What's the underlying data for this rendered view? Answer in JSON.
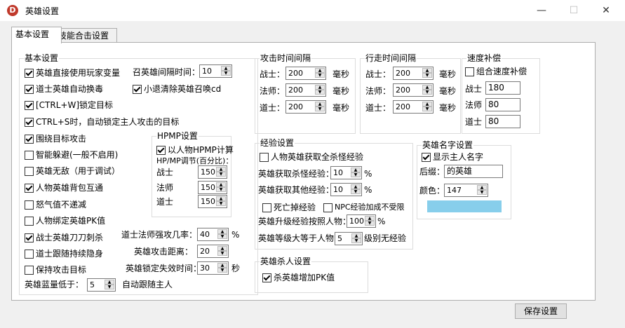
{
  "window": {
    "title": "英雄设置",
    "icon": "D",
    "minimize": "—",
    "maximize": "☐",
    "close": "✕"
  },
  "tabs": [
    {
      "label": "基本设置"
    },
    {
      "label": "技能合击设置"
    }
  ],
  "basic": {
    "title": "基本设置",
    "options": [
      {
        "label": "英雄直接使用玩家变量",
        "checked": true
      },
      {
        "label": "道士英雄自动换毒",
        "checked": true
      },
      {
        "label": "[CTRL+W]锁定目标",
        "checked": true
      },
      {
        "label": "CTRL+S时，自动锁定主人攻击的目标",
        "checked": true
      },
      {
        "label": "围绕目标攻击",
        "checked": true
      },
      {
        "label": "智能躲避(一般不启用)",
        "checked": false
      },
      {
        "label": "英雄无敌（用于调试）",
        "checked": false
      },
      {
        "label": "人物英雄背包互通",
        "checked": true
      },
      {
        "label": "怒气值不递减",
        "checked": false
      },
      {
        "label": "人物绑定英雄PK值",
        "checked": false
      },
      {
        "label": "战士英雄刀刀刺杀",
        "checked": true
      },
      {
        "label": "道士跟随持续隐身",
        "checked": false
      },
      {
        "label": "保持攻击目标",
        "checked": false
      }
    ],
    "summon_interval": {
      "label": "召英雄间隔时间：",
      "value": "10"
    },
    "retreat_clear": {
      "label": "小退清除英雄召唤cd",
      "checked": true
    },
    "tao_mage_rate": {
      "label": "道士法师强攻几率：",
      "value": "40",
      "unit": "%"
    },
    "attack_range": {
      "label": "英雄攻击距离：",
      "value": "20"
    },
    "lock_timeout": {
      "label": "英雄锁定失效时间：",
      "value": "30",
      "unit": "秒"
    },
    "mp_follow": {
      "label": "英雄蓝量低于：",
      "value": "5",
      "suffix": "自动跟随主人"
    }
  },
  "hpmp": {
    "title": "HPMP设置",
    "use_player": {
      "label": "以人物HPMP计算",
      "checked": true
    },
    "adjust_label": "HP/MP调节(百分比)：",
    "rows": [
      {
        "label": "战士",
        "value": "150"
      },
      {
        "label": "法师",
        "value": "150"
      },
      {
        "label": "道士",
        "value": "150"
      }
    ]
  },
  "attack_interval": {
    "title": "攻击时间间隔",
    "unit": "毫秒",
    "rows": [
      {
        "label": "战士：",
        "value": "200"
      },
      {
        "label": "法师：",
        "value": "200"
      },
      {
        "label": "道士：",
        "value": "200"
      }
    ]
  },
  "walk_interval": {
    "title": "行走时间间隔",
    "unit": "毫秒",
    "rows": [
      {
        "label": "战士：",
        "value": "200"
      },
      {
        "label": "法师：",
        "value": "200"
      },
      {
        "label": "道士：",
        "value": "200"
      }
    ]
  },
  "speed": {
    "title": "速度补偿",
    "combo": {
      "label": "组合速度补偿",
      "checked": false
    },
    "rows": [
      {
        "label": "战士",
        "value": "180"
      },
      {
        "label": "法师",
        "value": "80"
      },
      {
        "label": "道士",
        "value": "80"
      }
    ]
  },
  "exp": {
    "title": "经验设置",
    "all_kill": {
      "label": "人物英雄获取全杀怪经验",
      "checked": false
    },
    "kill_exp": {
      "label": "英雄获取杀怪经验：",
      "value": "10",
      "unit": "%"
    },
    "other_exp": {
      "label": "英雄获取其他经验：",
      "value": "10",
      "unit": "%"
    },
    "death_drop": {
      "label": "死亡掉经验",
      "checked": false
    },
    "npc_unlimited": {
      "label": "NPC经验加成不受限",
      "checked": false
    },
    "upgrade": {
      "label": "英雄升级经验按照人物：",
      "value": "100",
      "unit": "%"
    },
    "level_no_exp": {
      "label": "英雄等级大等于人物",
      "value": "5",
      "suffix": "级别无经验"
    }
  },
  "kill": {
    "title": "英雄杀人设置",
    "pk": {
      "label": "杀英雄增加PK值",
      "checked": true
    }
  },
  "name": {
    "title": "英雄名字设置",
    "show_master": {
      "label": "显示主人名字",
      "checked": true
    },
    "suffix_label": "后缀：",
    "suffix_value": "的英雄",
    "color_label": "颜色：",
    "color_value": "147",
    "swatch_color": "#87ceeb"
  },
  "save_button": "保存设置"
}
